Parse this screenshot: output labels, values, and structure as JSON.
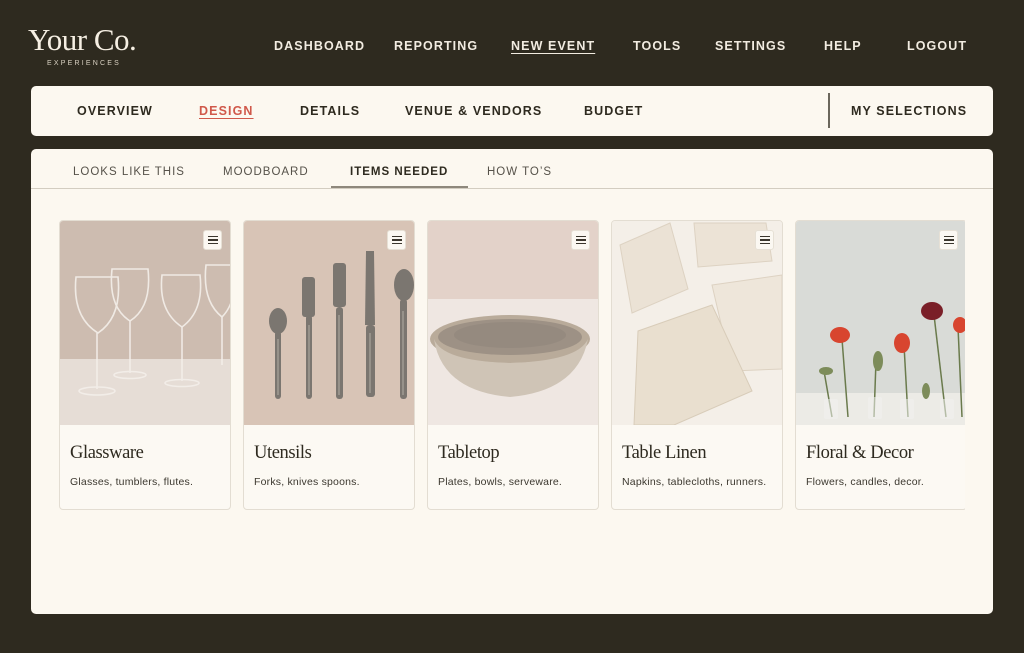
{
  "brand": {
    "name": "Your Co.",
    "tagline": "EXPERIENCES"
  },
  "topnav": {
    "items": [
      {
        "label": "DASHBOARD",
        "active": false
      },
      {
        "label": "REPORTING",
        "active": false
      },
      {
        "label": "NEW EVENT",
        "active": true
      },
      {
        "label": "TOOLS",
        "active": false
      },
      {
        "label": "SETTINGS",
        "active": false
      },
      {
        "label": "HELP",
        "active": false
      },
      {
        "label": "LOGOUT",
        "active": false
      }
    ]
  },
  "sections": {
    "tabs": [
      {
        "label": "OVERVIEW",
        "active": false
      },
      {
        "label": "DESIGN",
        "active": true
      },
      {
        "label": "DETAILS",
        "active": false
      },
      {
        "label": "VENUE & VENDORS",
        "active": false
      },
      {
        "label": "BUDGET",
        "active": false
      }
    ],
    "my_selections": "MY SELECTIONS"
  },
  "subtabs": {
    "items": [
      {
        "label": "LOOKS LIKE THIS",
        "active": false
      },
      {
        "label": "MOODBOARD",
        "active": false
      },
      {
        "label": "ITEMS NEEDED",
        "active": true
      },
      {
        "label": "HOW TO’S",
        "active": false
      }
    ]
  },
  "cards": [
    {
      "title": "Glassware",
      "description": "Glasses, tumblers, flutes.",
      "icon": "list-icon"
    },
    {
      "title": "Utensils",
      "description": "Forks, knives spoons.",
      "icon": "list-icon"
    },
    {
      "title": "Tabletop",
      "description": "Plates, bowls, serveware.",
      "icon": "list-icon"
    },
    {
      "title": "Table Linen",
      "description": "Napkins, tablecloths, runners.",
      "icon": "list-icon"
    },
    {
      "title": "Floral & Decor",
      "description": "Flowers, candles, decor.",
      "icon": "list-icon"
    }
  ],
  "colors": {
    "background": "#2e2a1f",
    "panel": "#fcf8f0",
    "accent": "#d0584a"
  }
}
